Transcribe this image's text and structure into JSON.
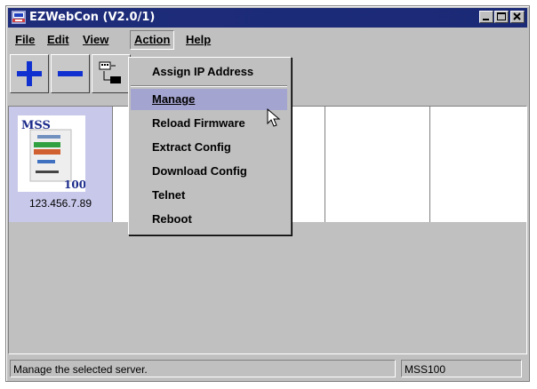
{
  "window": {
    "title": "EZWebCon (V2.0/1)",
    "titlebar_color": "#1e2c7a"
  },
  "menubar": {
    "file": "File",
    "edit": "Edit",
    "view": "View",
    "action": "Action",
    "help": "Help"
  },
  "toolbar": {
    "add_icon": "plus-icon",
    "remove_icon": "minus-icon",
    "config_icon": "network-config-icon"
  },
  "action_menu": {
    "items": [
      {
        "label": "Assign IP Address"
      },
      {
        "label": "Manage",
        "highlighted": true
      },
      {
        "label": "Reload Firmware"
      },
      {
        "label": "Extract Config"
      },
      {
        "label": "Download Config"
      },
      {
        "label": "Telnet"
      },
      {
        "label": "Reboot"
      }
    ]
  },
  "devices": [
    {
      "label": "123.456.7.89",
      "model_text": "MSS",
      "model_number": "100",
      "selected": true
    }
  ],
  "statusbar": {
    "message": "Manage the selected server.",
    "model": "MSS100"
  },
  "colors": {
    "selected_cell": "#c8c8ea",
    "menu_highlight": "#a4a4d0",
    "plus_minus": "#1030d0"
  }
}
